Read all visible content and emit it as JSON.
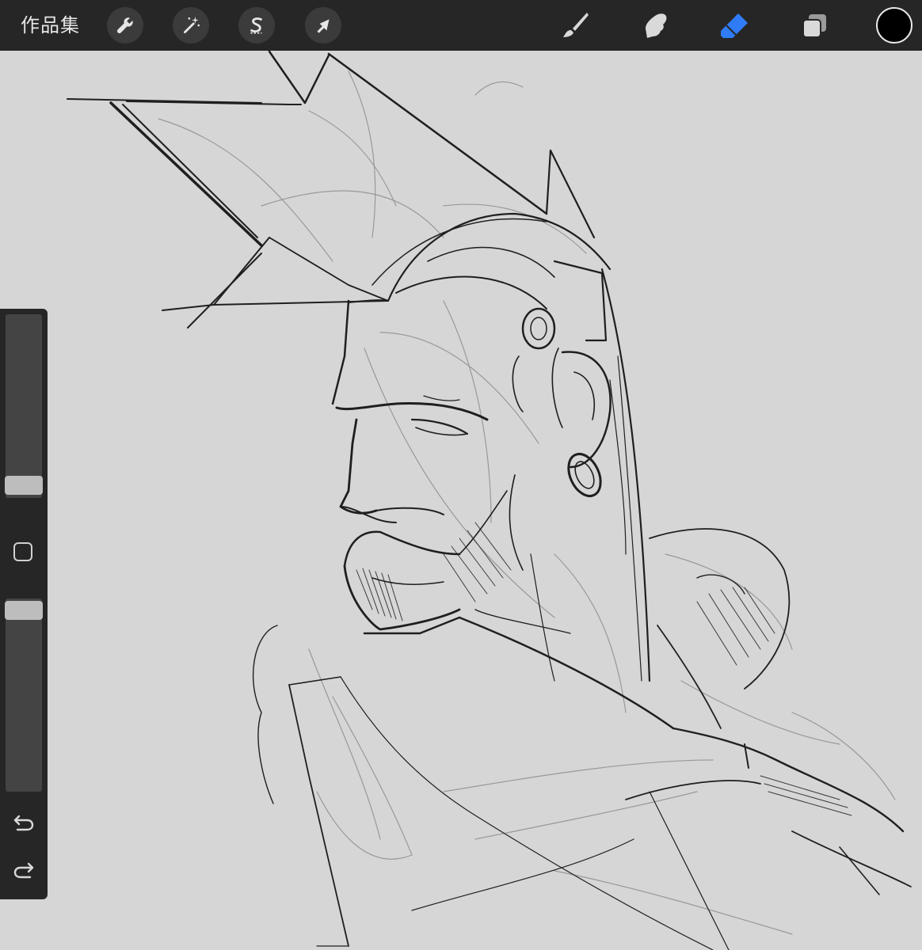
{
  "toolbar": {
    "gallery_label": "作品集",
    "left_tools": [
      {
        "name": "actions",
        "icon": "wrench-icon"
      },
      {
        "name": "adjustments",
        "icon": "magic-wand-icon"
      },
      {
        "name": "selection",
        "icon": "selection-s-icon"
      },
      {
        "name": "transform",
        "icon": "arrow-cursor-icon"
      }
    ],
    "right_tools": [
      {
        "name": "brush",
        "icon": "brush-icon",
        "active": false
      },
      {
        "name": "smudge",
        "icon": "smudge-finger-icon",
        "active": false
      },
      {
        "name": "eraser",
        "icon": "eraser-icon",
        "active": true
      },
      {
        "name": "layers",
        "icon": "layers-icon",
        "active": false
      }
    ],
    "current_color": "#000000"
  },
  "sidebar": {
    "brush_size_level": 0.05,
    "opacity_level": 0.95,
    "modify_button": "square-icon",
    "undo_icon": "undo-icon",
    "redo_icon": "redo-icon"
  },
  "colors": {
    "toolbar_bg": "#262626",
    "canvas_bg": "#d6d6d6",
    "active_tool": "#2f7cf6",
    "stroke": "#1c1c1c"
  }
}
